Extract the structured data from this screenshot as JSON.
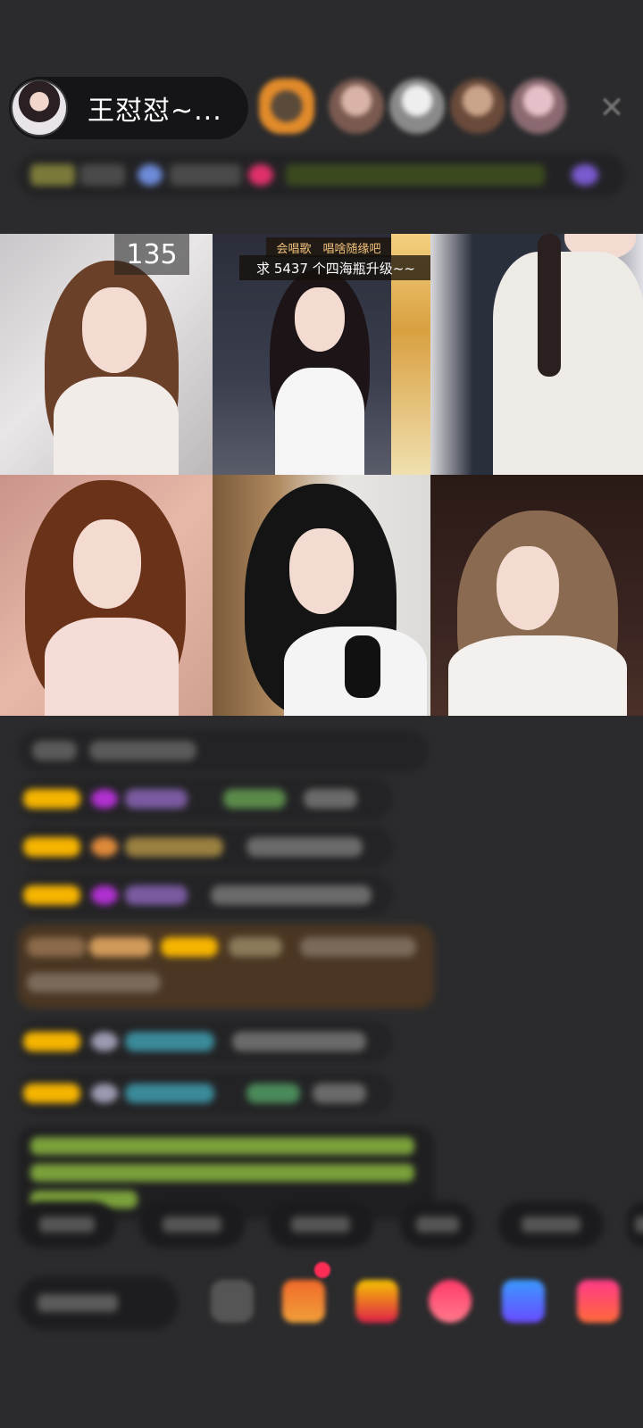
{
  "header": {
    "host_name": "王怼怼~..."
  },
  "grid": {
    "tile_1_count": "135",
    "tile_2_caption_top": "会唱歌　唱啥随缘吧",
    "tile_2_caption_main": "求 5437 个四海瓶升级~~"
  },
  "icons": {
    "close": "close-icon",
    "gift": "gift-icon"
  },
  "colors": {
    "background": "#2b2b2d",
    "accent_red": "#ff2d55",
    "level_badge": "#f5b400"
  }
}
